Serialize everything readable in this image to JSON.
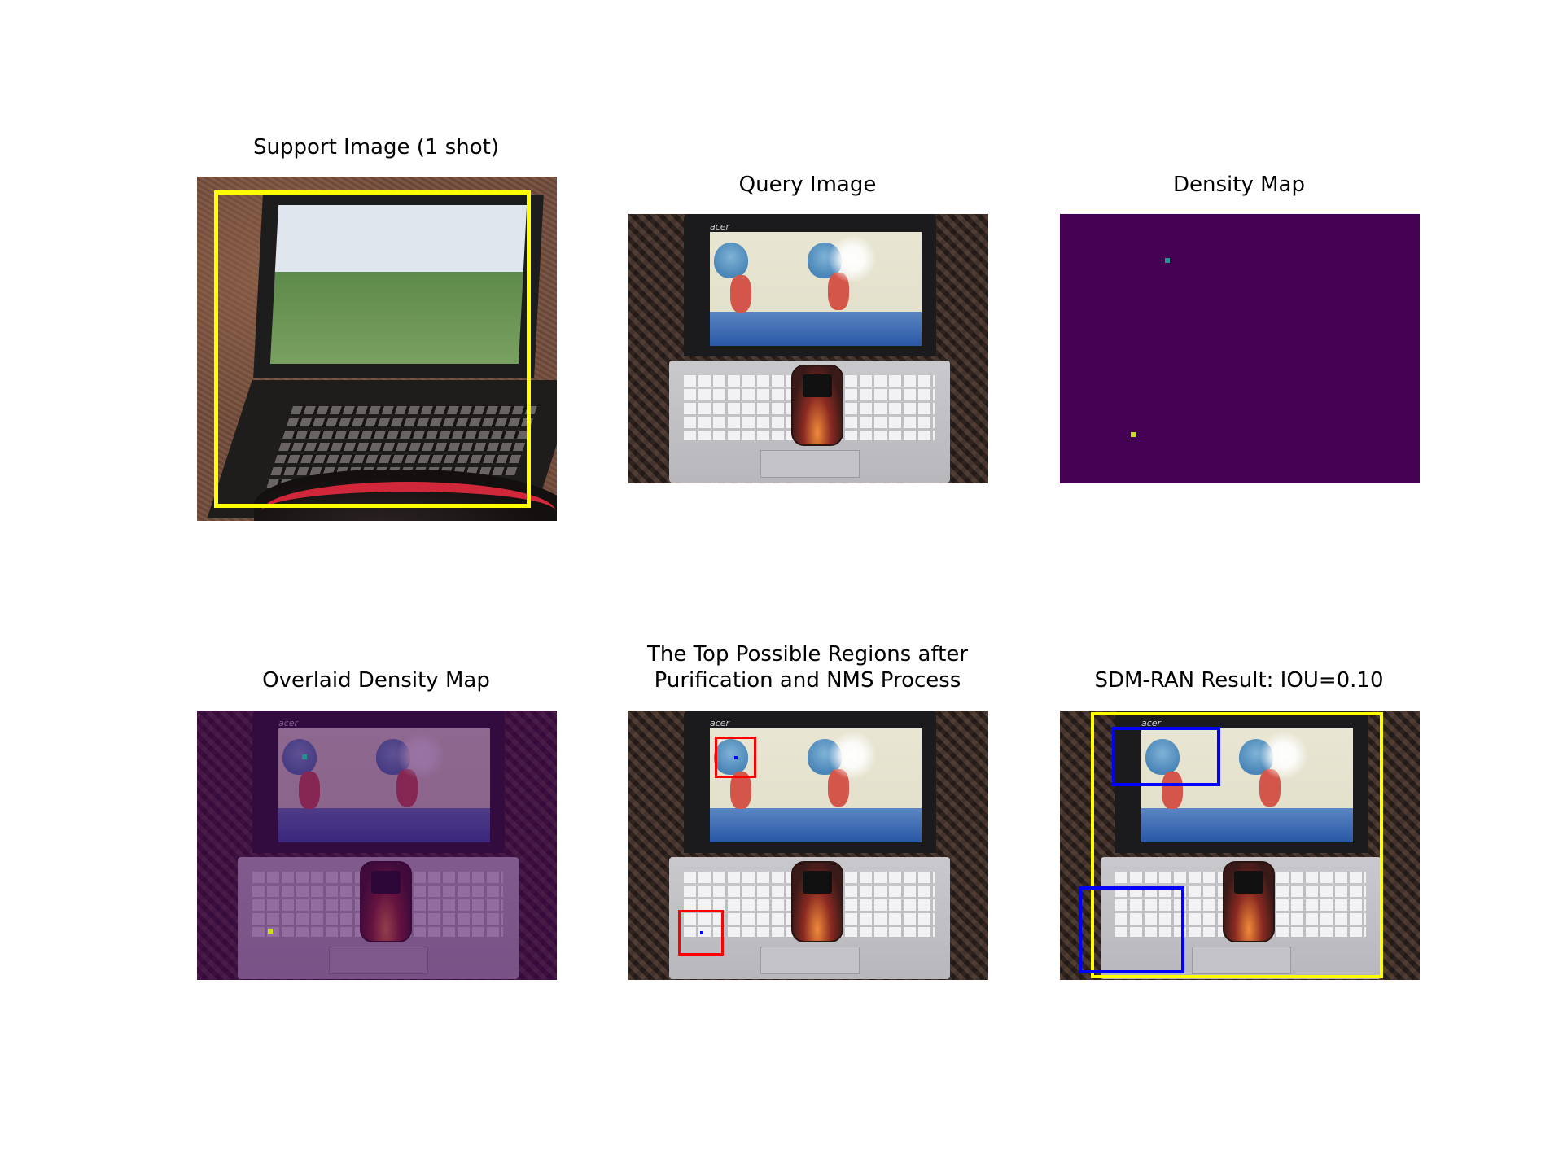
{
  "figure": {
    "panels": [
      {
        "title": "Support Image (1 shot)"
      },
      {
        "title": "Query Image"
      },
      {
        "title": "Density Map"
      },
      {
        "title": "Overlaid Density Map"
      },
      {
        "title_line1": "The Top Possible Regions after",
        "title_line2": "Purification and NMS Process"
      },
      {
        "title": "SDM-RAN Result: IOU=0.10"
      }
    ],
    "query_image": {
      "brand_text": "acer"
    },
    "colors": {
      "support_box": "#ffff00",
      "result_box": "#ffff00",
      "region_box": "#ff0000",
      "pred_box": "#0000ff",
      "density_background": "#440154",
      "density_peak_1": "#21918c",
      "density_peak_2": "#c8e020"
    }
  }
}
